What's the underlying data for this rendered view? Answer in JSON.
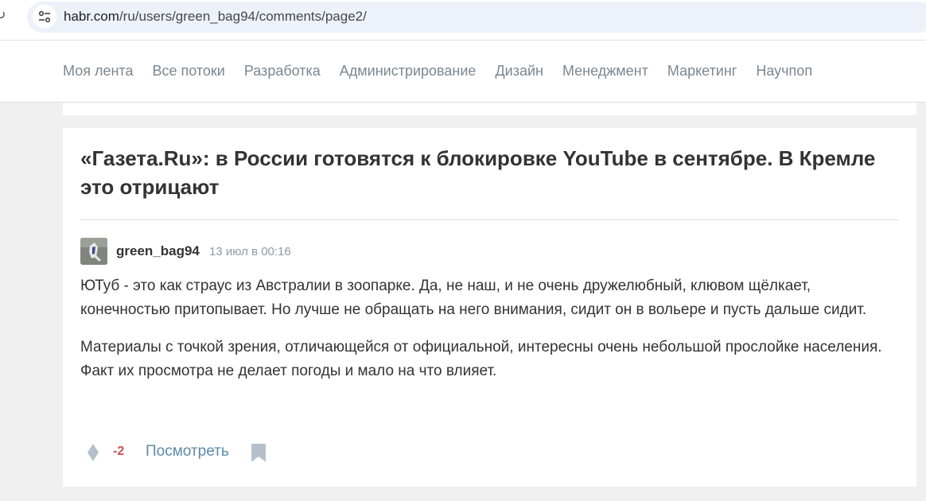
{
  "browser": {
    "url_host": "habr.com",
    "url_path": "/ru/users/green_bag94/comments/page2/"
  },
  "nav": {
    "items": [
      "Моя лента",
      "Все потоки",
      "Разработка",
      "Администрирование",
      "Дизайн",
      "Менеджмент",
      "Маркетинг",
      "Научпоп"
    ]
  },
  "post": {
    "title": "«Газета.Ru»: в России готовятся к блокировке YouTube в сентябре. В Кремле это отрицают"
  },
  "comment": {
    "author": "green_bag94",
    "time": "13 июл в 00:16",
    "paragraphs": [
      "ЮТуб - это как страус из Австралии в зоопарке. Да, не наш, и не очень дружелюбный, клювом щёлкает, конечностью притопывает. Но лучше не обращать на него внимания, сидит он в вольере и пусть дальше сидит.",
      "Материалы с точкой зрения, отличающейся от официальной, интересны очень небольшой прослойке населения. Факт их просмотра не делает погоды и мало на что влияет."
    ],
    "score": "-2",
    "view_label": "Посмотреть"
  },
  "icons": {
    "reload": "reload-icon",
    "site_info": "tune-icon",
    "vote": "vote-diamond-icon",
    "bookmark": "bookmark-icon"
  },
  "colors": {
    "score_negative": "#d04e4e",
    "link": "#5e8aa8",
    "nav_text": "#7b8790",
    "page_bg": "#f0f0f0"
  }
}
